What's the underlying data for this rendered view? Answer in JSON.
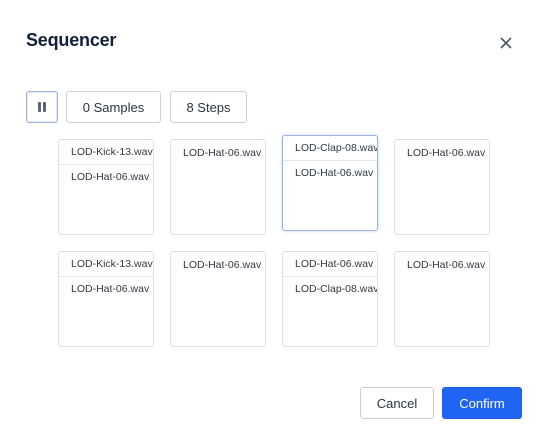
{
  "dialog": {
    "title": "Sequencer",
    "close_icon": "close-icon"
  },
  "toolbar": {
    "pause_icon": "pause-icon",
    "samples_label": "0 Samples",
    "steps_label": "8 Steps"
  },
  "steps": [
    {
      "samples": [
        "LOD-Kick-13.wav",
        "LOD-Hat-06.wav"
      ],
      "active": false
    },
    {
      "samples": [
        "LOD-Hat-06.wav"
      ],
      "active": false
    },
    {
      "samples": [
        "LOD-Clap-08.wav",
        "LOD-Hat-06.wav"
      ],
      "active": true
    },
    {
      "samples": [
        "LOD-Hat-06.wav"
      ],
      "active": false
    },
    {
      "samples": [
        "LOD-Kick-13.wav",
        "LOD-Hat-06.wav"
      ],
      "active": false
    },
    {
      "samples": [
        "LOD-Hat-06.wav"
      ],
      "active": false
    },
    {
      "samples": [
        "LOD-Hat-06.wav",
        "LOD-Clap-08.wav"
      ],
      "active": false
    },
    {
      "samples": [
        "LOD-Hat-06.wav"
      ],
      "active": false
    }
  ],
  "footer": {
    "cancel_label": "Cancel",
    "confirm_label": "Confirm"
  },
  "colors": {
    "accent": "#1f64f2",
    "active_border": "#9cb3e0",
    "border": "#dde1e7"
  }
}
